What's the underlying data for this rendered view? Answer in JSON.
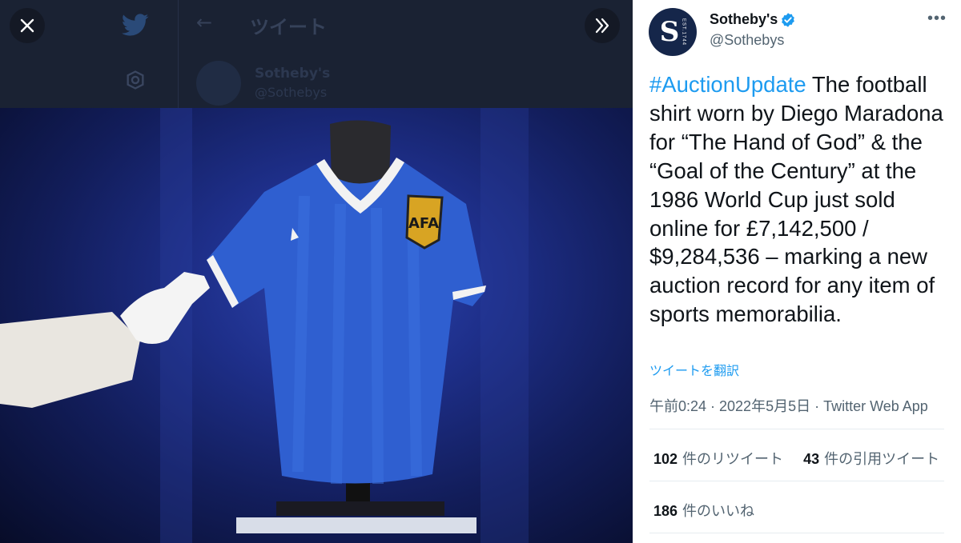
{
  "viewer": {
    "background_header_title": "ツイート",
    "background_name": "Sotheby's",
    "background_handle": "@Sothebys",
    "close_icon": "close-icon",
    "next_icon": "chevron-double-right-icon"
  },
  "tweet": {
    "display_name": "Sotheby's",
    "handle": "@Sothebys",
    "verified_icon": "verified-badge-icon",
    "more_icon": "more-horizontal-icon",
    "hashtag": "#AuctionUpdate",
    "body": " The football shirt worn by Diego Maradona for “The Hand of God” & the “Goal of the Century” at the 1986 World Cup just sold online for £7,142,500 / $9,284,536 – marking a new auction record for any item of sports memorabilia.",
    "translate_label": "ツイートを翻訳",
    "timestamp": "午前0:24 · 2022年5月5日 · Twitter Web App",
    "retweets_count": "102",
    "retweets_label": "件のリツイート",
    "quotes_count": "43",
    "quotes_label": "件の引用ツイート",
    "likes_count": "186",
    "likes_label": "件のいいね"
  },
  "colors": {
    "link": "#1d9bf0",
    "text": "#0f1419",
    "secondary": "#536471",
    "shirt_blue": "#2f5fd0"
  }
}
